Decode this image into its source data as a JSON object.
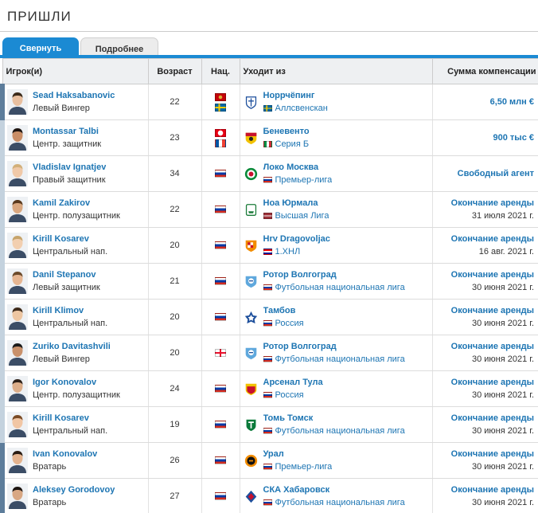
{
  "page": {
    "title": "ПРИШЛИ"
  },
  "tabs": [
    {
      "label": "Свернуть",
      "active": true
    },
    {
      "label": "Подробнее",
      "active": false
    }
  ],
  "table": {
    "headers": {
      "player": "Игрок(и)",
      "age": "Возраст",
      "nat": "Нац.",
      "from": "Уходит из",
      "fee": "Сумма компенсации"
    },
    "rows": [
      {
        "name": "Sead Haksabanovic",
        "position": "Левый Вингер",
        "age": "22",
        "flags": [
          "montenegro",
          "sweden"
        ],
        "club": "Норрчёпинг",
        "club_crest": "crest-norrkoping",
        "league_flag": "sweden",
        "league": "Аллсвенскан",
        "fee": "6,50 млн €",
        "fee_date": ""
      },
      {
        "name": "Montassar Talbi",
        "position": "Центр. защитник",
        "age": "23",
        "flags": [
          "tunisia",
          "france"
        ],
        "club": "Беневенто",
        "club_crest": "crest-benevento",
        "league_flag": "italy",
        "league": "Серия Б",
        "fee": "900 тыс €",
        "fee_date": ""
      },
      {
        "name": "Vladislav Ignatjev",
        "position": "Правый защитник",
        "age": "34",
        "flags": [
          "russia"
        ],
        "club": "Локо Москва",
        "club_crest": "crest-lokomotiv",
        "league_flag": "russia",
        "league": "Премьер-лига",
        "fee": "Свободный агент",
        "fee_date": ""
      },
      {
        "name": "Kamil Zakirov",
        "position": "Центр. полузащитник",
        "age": "22",
        "flags": [
          "russia"
        ],
        "club": "Ноа Юрмала",
        "club_crest": "crest-noah-jurmala",
        "league_flag": "latvia",
        "league": "Высшая Лига",
        "fee": "Окончание аренды",
        "fee_date": "31 июля 2021 г."
      },
      {
        "name": "Kirill Kosarev",
        "position": "Центральный нап.",
        "age": "20",
        "flags": [
          "russia"
        ],
        "club": "Hrv Dragovoljac",
        "club_crest": "crest-dragovoljac",
        "league_flag": "croatia",
        "league": "1.ХНЛ",
        "fee": "Окончание аренды",
        "fee_date": "16 авг. 2021 г."
      },
      {
        "name": "Danil Stepanov",
        "position": "Левый защитник",
        "age": "21",
        "flags": [
          "russia"
        ],
        "club": "Ротор Волгоград",
        "club_crest": "crest-rotor",
        "league_flag": "russia",
        "league": "Футбольная национальная лига",
        "fee": "Окончание аренды",
        "fee_date": "30 июня 2021 г."
      },
      {
        "name": "Kirill Klimov",
        "position": "Центральный нап.",
        "age": "20",
        "flags": [
          "russia"
        ],
        "club": "Тамбов",
        "club_crest": "crest-tambov",
        "league_flag": "russia",
        "league": "Россия",
        "fee": "Окончание аренды",
        "fee_date": "30 июня 2021 г."
      },
      {
        "name": "Zuriko Davitashvili",
        "position": "Левый Вингер",
        "age": "20",
        "flags": [
          "georgia"
        ],
        "club": "Ротор Волгоград",
        "club_crest": "crest-rotor",
        "league_flag": "russia",
        "league": "Футбольная национальная лига",
        "fee": "Окончание аренды",
        "fee_date": "30 июня 2021 г."
      },
      {
        "name": "Igor Konovalov",
        "position": "Центр. полузащитник",
        "age": "24",
        "flags": [
          "russia"
        ],
        "club": "Арсенал Тула",
        "club_crest": "crest-arsenal-tula",
        "league_flag": "russia",
        "league": "Россия",
        "fee": "Окончание аренды",
        "fee_date": "30 июня 2021 г."
      },
      {
        "name": "Kirill Kosarev",
        "position": "Центральный нап.",
        "age": "19",
        "flags": [
          "russia"
        ],
        "club": "Томь Томск",
        "club_crest": "crest-tom-tomsk",
        "league_flag": "russia",
        "league": "Футбольная национальная лига",
        "fee": "Окончание аренды",
        "fee_date": "30 июня 2021 г."
      },
      {
        "name": "Ivan Konovalov",
        "position": "Вратарь",
        "age": "26",
        "flags": [
          "russia"
        ],
        "club": "Урал",
        "club_crest": "crest-ural",
        "league_flag": "russia",
        "league": "Премьер-лига",
        "fee": "Окончание аренды",
        "fee_date": "30 июня 2021 г."
      },
      {
        "name": "Aleksey Gorodovoy",
        "position": "Вратарь",
        "age": "27",
        "flags": [
          "russia"
        ],
        "club": "СКА Хабаровск",
        "club_crest": "crest-ska-khabarovsk",
        "league_flag": "russia",
        "league": "Футбольная национальная лига",
        "fee": "Окончание аренды",
        "fee_date": "30 июня 2021 г."
      }
    ]
  },
  "colors": {
    "accent": "#1b8ad3",
    "link": "#1d75b3",
    "header_bg": "#eef0f2"
  }
}
